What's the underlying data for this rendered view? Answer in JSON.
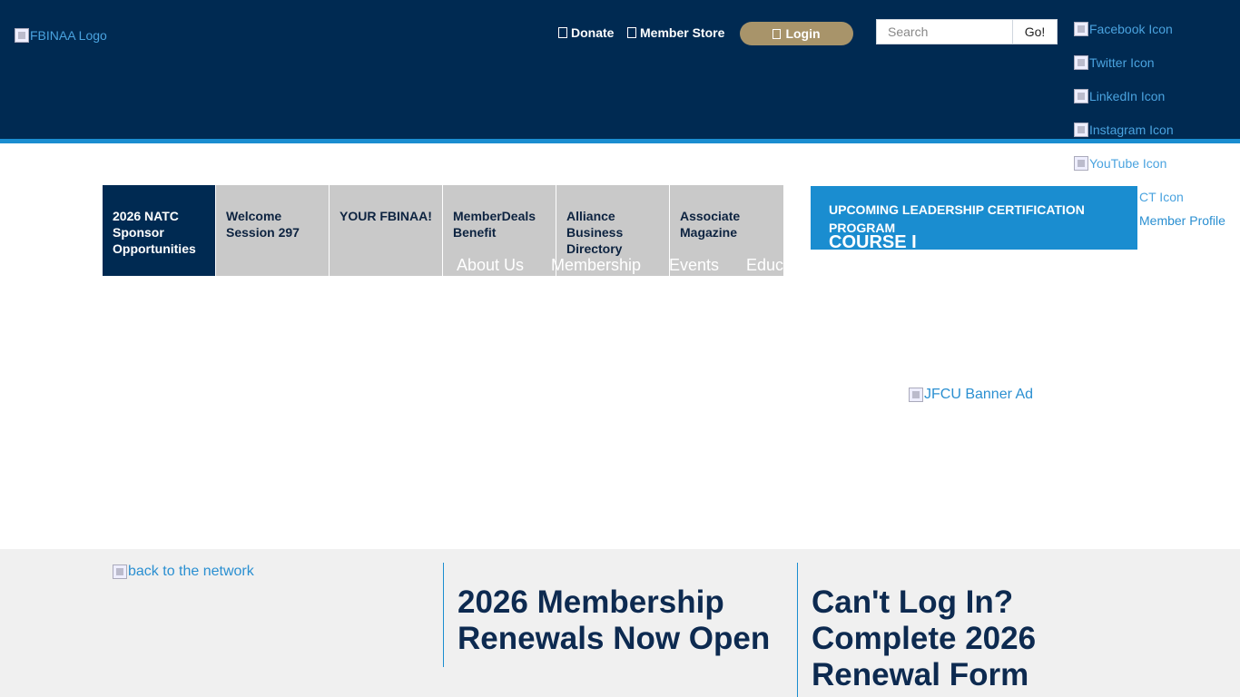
{
  "header": {
    "logo_alt": "FBINAA Logo",
    "donate_label": "Donate",
    "store_label": "Member Store",
    "login_label": "Login",
    "search_placeholder": "Search",
    "search_button": "Go!"
  },
  "social": {
    "facebook": "Facebook Icon",
    "twitter": "Twitter Icon",
    "linkedin": "LinkedIn Icon",
    "instagram": "Instagram Icon",
    "youtube": "YouTube Icon",
    "extra": "CT Icon",
    "member_profile": "Member Profile"
  },
  "tabs": [
    "2026 NATC Sponsor Opportunities",
    "Welcome Session 297",
    "YOUR FBINAA!",
    "MemberDeals Benefit",
    "Alliance Business Directory",
    "Associate Magazine"
  ],
  "main_nav": [
    "About Us",
    "Membership",
    "Events",
    "Educ"
  ],
  "promo": {
    "title": "UPCOMING LEADERSHIP CERTIFICATION PROGRAM",
    "subtitle": "COURSE I"
  },
  "banner_ad_alt": "JFCU Banner Ad",
  "footer": {
    "back_link": "back to the network",
    "news1": "2026 Membership Renewals Now Open",
    "news2": "Can't Log In? Complete 2026 Renewal Form"
  },
  "colors": {
    "header_bg": "#002a52",
    "accent_blue": "#1a8dd0",
    "login_gold": "#a8946a",
    "tab_gray": "#c9c9c9",
    "footer_bg": "#f0f0f0"
  }
}
